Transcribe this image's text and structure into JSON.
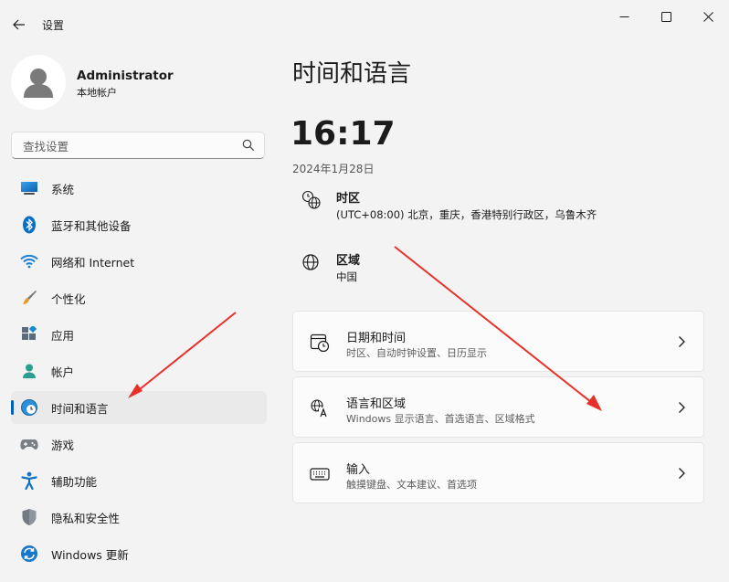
{
  "window": {
    "title": "设置",
    "controls": [
      "minimize",
      "maximize",
      "close"
    ]
  },
  "profile": {
    "name": "Administrator",
    "account_type": "本地帐户"
  },
  "search": {
    "placeholder": "查找设置"
  },
  "sidebar": {
    "items": [
      {
        "label": "系统",
        "icon": "system-icon"
      },
      {
        "label": "蓝牙和其他设备",
        "icon": "bluetooth-icon"
      },
      {
        "label": "网络和 Internet",
        "icon": "wifi-icon"
      },
      {
        "label": "个性化",
        "icon": "brush-icon"
      },
      {
        "label": "应用",
        "icon": "apps-icon"
      },
      {
        "label": "帐户",
        "icon": "account-icon"
      },
      {
        "label": "时间和语言",
        "icon": "time-language-icon",
        "active": true
      },
      {
        "label": "游戏",
        "icon": "gamepad-icon"
      },
      {
        "label": "辅助功能",
        "icon": "accessibility-icon"
      },
      {
        "label": "隐私和安全性",
        "icon": "shield-icon"
      },
      {
        "label": "Windows 更新",
        "icon": "update-icon"
      }
    ]
  },
  "main": {
    "title": "时间和语言",
    "time": "16:17",
    "date": "2024年1月28日",
    "timezone": {
      "title": "时区",
      "value": "(UTC+08:00) 北京，重庆，香港特别行政区，乌鲁木齐"
    },
    "region": {
      "title": "区域",
      "value": "中国"
    },
    "cards": [
      {
        "title": "日期和时间",
        "subtitle": "时区、自动时钟设置、日历显示",
        "icon": "calendar-clock-icon"
      },
      {
        "title": "语言和区域",
        "subtitle": "Windows 显示语言、首选语言、区域格式",
        "icon": "language-icon"
      },
      {
        "title": "输入",
        "subtitle": "触摸键盘、文本建议、首选项",
        "icon": "keyboard-icon"
      }
    ]
  },
  "colors": {
    "accent": "#005fb8",
    "annotation_arrow": "#e8302a"
  }
}
